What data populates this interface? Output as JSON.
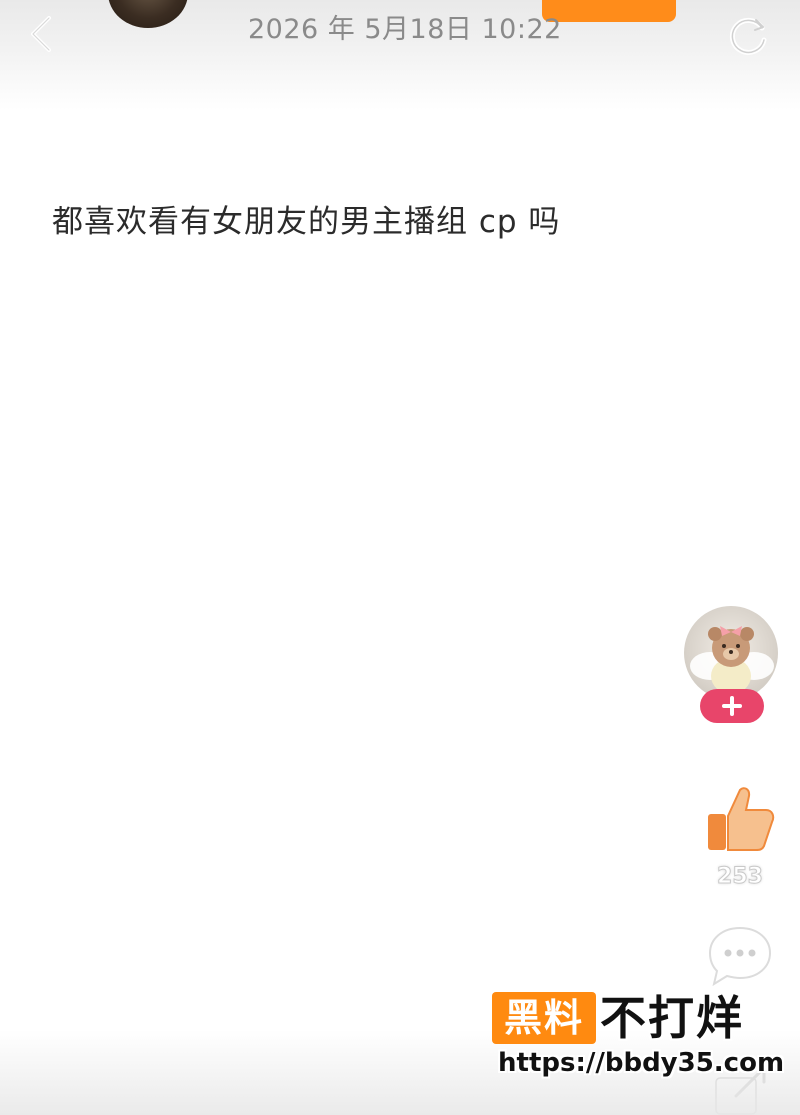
{
  "header": {
    "post_time": "2026 年 5月18日 10:22",
    "back_icon": "chevron-left-icon",
    "refresh_icon": "refresh-icon"
  },
  "post": {
    "text": "都喜欢看有女朋友的男主播组 cp 吗"
  },
  "actions": {
    "follow_plus_icon": "plus-icon",
    "like_icon": "thumbs-up-icon",
    "like_count": "253",
    "comment_icon": "comment-bubble-icon",
    "share_icon": "share-icon"
  },
  "watermark": {
    "badge": "黑料",
    "slogan": "不打烊",
    "url": "https://bbdy35.com"
  },
  "colors": {
    "follow_orange": "#ff8c1a",
    "plus_pink": "#e8456a",
    "like_orange": "#f08a3c",
    "watermark_orange": "#ff8a10"
  }
}
